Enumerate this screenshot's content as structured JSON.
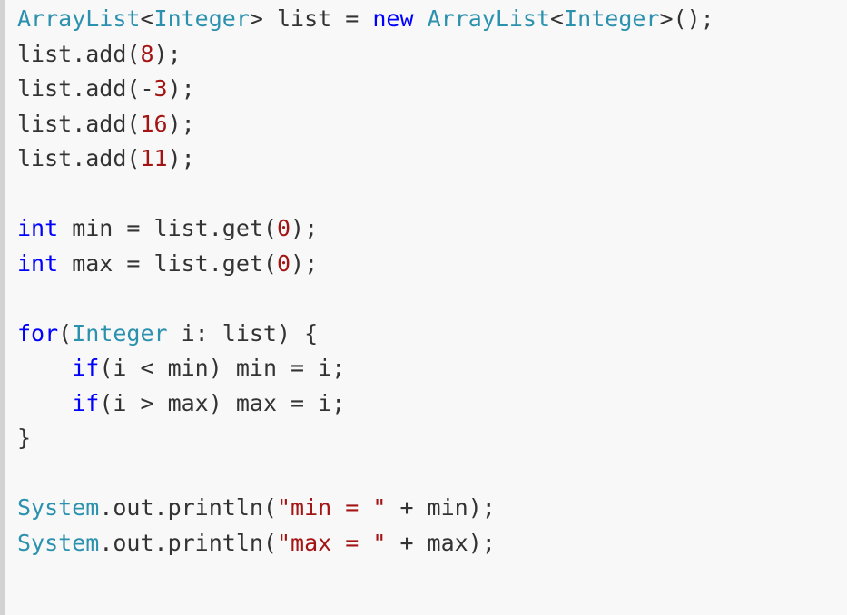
{
  "editor": {
    "colors": {
      "background": "#f8f8f8",
      "left_border": "#d2d2d2",
      "plain_text": "#333333",
      "type_name": "#2b91af",
      "keyword": "#0000ff",
      "literal": "#a31515"
    },
    "lines": [
      {
        "tokens": [
          {
            "text": "ArrayList",
            "kind": "type"
          },
          {
            "text": "<",
            "kind": "plain"
          },
          {
            "text": "Integer",
            "kind": "type"
          },
          {
            "text": "> list = ",
            "kind": "plain"
          },
          {
            "text": "new",
            "kind": "kw"
          },
          {
            "text": " ",
            "kind": "plain"
          },
          {
            "text": "ArrayList",
            "kind": "type"
          },
          {
            "text": "<",
            "kind": "plain"
          },
          {
            "text": "Integer",
            "kind": "type"
          },
          {
            "text": ">();",
            "kind": "plain"
          }
        ]
      },
      {
        "tokens": [
          {
            "text": "list.add(",
            "kind": "plain"
          },
          {
            "text": "8",
            "kind": "num"
          },
          {
            "text": ");",
            "kind": "plain"
          }
        ]
      },
      {
        "tokens": [
          {
            "text": "list.add(-",
            "kind": "plain"
          },
          {
            "text": "3",
            "kind": "num"
          },
          {
            "text": ");",
            "kind": "plain"
          }
        ]
      },
      {
        "tokens": [
          {
            "text": "list.add(",
            "kind": "plain"
          },
          {
            "text": "16",
            "kind": "num"
          },
          {
            "text": ");",
            "kind": "plain"
          }
        ]
      },
      {
        "tokens": [
          {
            "text": "list.add(",
            "kind": "plain"
          },
          {
            "text": "11",
            "kind": "num"
          },
          {
            "text": ");",
            "kind": "plain"
          }
        ]
      },
      {
        "tokens": []
      },
      {
        "tokens": [
          {
            "text": "int",
            "kind": "kw"
          },
          {
            "text": " min = list.get(",
            "kind": "plain"
          },
          {
            "text": "0",
            "kind": "num"
          },
          {
            "text": ");",
            "kind": "plain"
          }
        ]
      },
      {
        "tokens": [
          {
            "text": "int",
            "kind": "kw"
          },
          {
            "text": " max = list.get(",
            "kind": "plain"
          },
          {
            "text": "0",
            "kind": "num"
          },
          {
            "text": ");",
            "kind": "plain"
          }
        ]
      },
      {
        "tokens": []
      },
      {
        "tokens": [
          {
            "text": "for",
            "kind": "kw"
          },
          {
            "text": "(",
            "kind": "plain"
          },
          {
            "text": "Integer",
            "kind": "type"
          },
          {
            "text": " i: list) {",
            "kind": "plain"
          }
        ]
      },
      {
        "tokens": [
          {
            "text": "    ",
            "kind": "plain"
          },
          {
            "text": "if",
            "kind": "kw"
          },
          {
            "text": "(i < min) min = i;",
            "kind": "plain"
          }
        ]
      },
      {
        "tokens": [
          {
            "text": "    ",
            "kind": "plain"
          },
          {
            "text": "if",
            "kind": "kw"
          },
          {
            "text": "(i > max) max = i;",
            "kind": "plain"
          }
        ]
      },
      {
        "tokens": [
          {
            "text": "}",
            "kind": "plain"
          }
        ]
      },
      {
        "tokens": []
      },
      {
        "tokens": [
          {
            "text": "System",
            "kind": "type"
          },
          {
            "text": ".out.println(",
            "kind": "plain"
          },
          {
            "text": "\"min = \"",
            "kind": "str"
          },
          {
            "text": " + min);",
            "kind": "plain"
          }
        ]
      },
      {
        "tokens": [
          {
            "text": "System",
            "kind": "type"
          },
          {
            "text": ".out.println(",
            "kind": "plain"
          },
          {
            "text": "\"max = \"",
            "kind": "str"
          },
          {
            "text": " + max);",
            "kind": "plain"
          }
        ]
      }
    ]
  }
}
